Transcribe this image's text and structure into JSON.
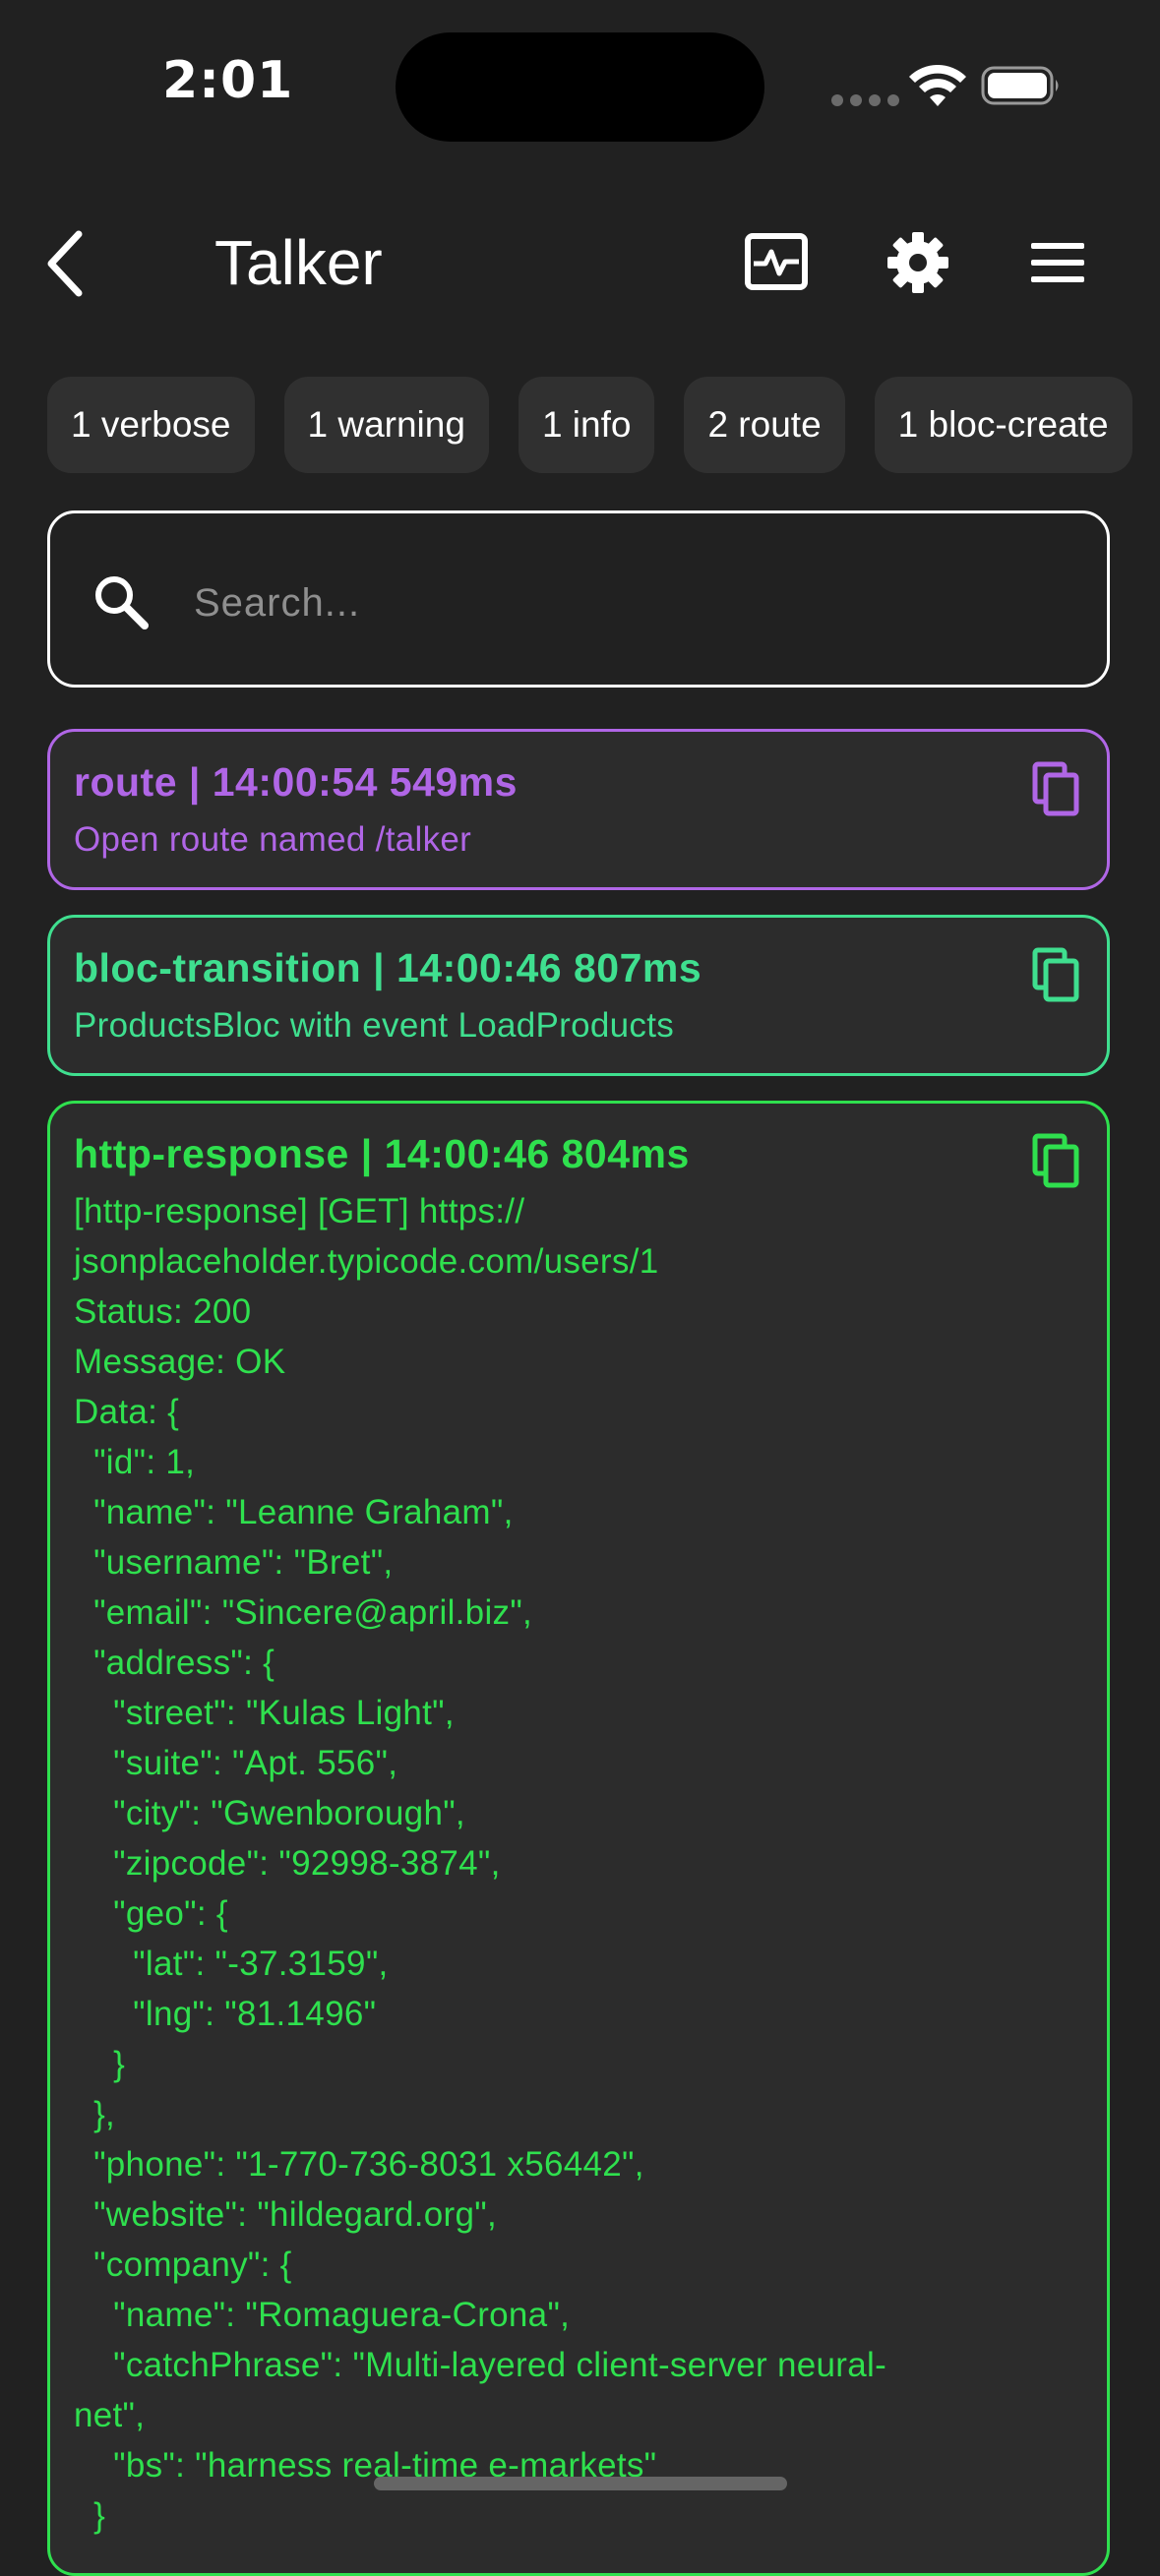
{
  "status_bar": {
    "time": "2:01"
  },
  "app_bar": {
    "title": "Talker",
    "icons": [
      "back-arrow-icon",
      "monitor-icon",
      "gear-icon",
      "menu-icon"
    ]
  },
  "filters": [
    {
      "label": "1 verbose"
    },
    {
      "label": "1 warning"
    },
    {
      "label": "1 info"
    },
    {
      "label": "2 route"
    },
    {
      "label": "1 bloc-create"
    }
  ],
  "search": {
    "placeholder": "Search...",
    "value": ""
  },
  "logs": [
    {
      "title": "route | 14:00:54 549ms",
      "body": "Open route named /talker",
      "color": "#b066e6"
    },
    {
      "title": "bloc-transition | 14:00:46 807ms",
      "body": "ProductsBloc with event LoadProducts",
      "color": "#3fdf8f"
    },
    {
      "title": "http-response | 14:00:46 804ms",
      "body": "[http-response] [GET] https://\njsonplaceholder.typicode.com/users/1\nStatus: 200\nMessage: OK\nData: {\n  \"id\": 1,\n  \"name\": \"Leanne Graham\",\n  \"username\": \"Bret\",\n  \"email\": \"Sincere@april.biz\",\n  \"address\": {\n    \"street\": \"Kulas Light\",\n    \"suite\": \"Apt. 556\",\n    \"city\": \"Gwenborough\",\n    \"zipcode\": \"92998-3874\",\n    \"geo\": {\n      \"lat\": \"-37.3159\",\n      \"lng\": \"81.1496\"\n    }\n  },\n  \"phone\": \"1-770-736-8031 x56442\",\n  \"website\": \"hildegard.org\",\n  \"company\": {\n    \"name\": \"Romaguera-Crona\",\n    \"catchPhrase\": \"Multi-layered client-server neural-\nnet\",\n    \"bs\": \"harness real-time e-markets\"\n  }",
      "color": "#2fe04e"
    }
  ]
}
